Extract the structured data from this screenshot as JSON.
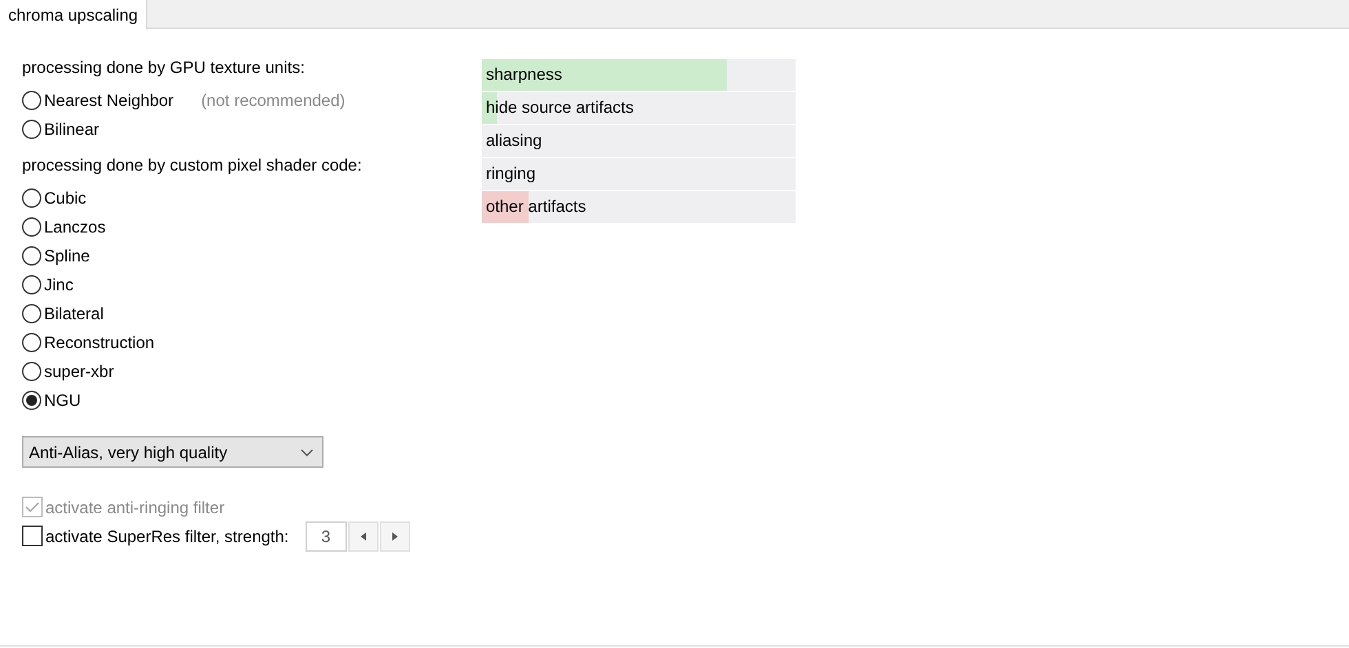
{
  "tabs": [
    {
      "label": "chroma upscaling",
      "selected": true
    }
  ],
  "groups": [
    {
      "heading": "processing done by GPU texture units:",
      "options": [
        {
          "label": "Nearest Neighbor",
          "note": "(not recommended)",
          "selected": false
        },
        {
          "label": "Bilinear",
          "selected": false
        }
      ]
    },
    {
      "heading": "processing done by custom pixel shader code:",
      "options": [
        {
          "label": "Cubic",
          "selected": false
        },
        {
          "label": "Lanczos",
          "selected": false
        },
        {
          "label": "Spline",
          "selected": false
        },
        {
          "label": "Jinc",
          "selected": false
        },
        {
          "label": "Bilateral",
          "selected": false
        },
        {
          "label": "Reconstruction",
          "selected": false
        },
        {
          "label": "super-xbr",
          "selected": false
        },
        {
          "label": "NGU",
          "selected": true
        }
      ]
    }
  ],
  "quality_dropdown": {
    "value": "Anti-Alias, very high quality"
  },
  "checkboxes": [
    {
      "label": "activate anti-ringing filter",
      "checked": true,
      "disabled": true
    },
    {
      "label": "activate SuperRes filter, strength:",
      "checked": false,
      "disabled": false,
      "strength": "3"
    }
  ],
  "meters": [
    {
      "label": "sharpness",
      "level": 0.78,
      "color": "#cdeccd"
    },
    {
      "label": "hide source artifacts",
      "level": 0.05,
      "color": "#cdeccd"
    },
    {
      "label": "aliasing"
    },
    {
      "label": "ringing"
    },
    {
      "label": "other artifacts",
      "level": 0.15,
      "color": "#f3cccc"
    }
  ]
}
